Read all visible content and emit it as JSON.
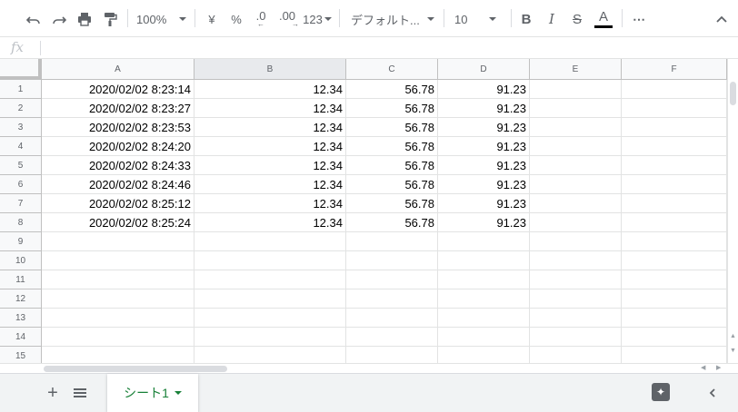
{
  "toolbar": {
    "zoom": "100%",
    "currency": "¥",
    "percent": "%",
    "decrease_decimal": ".0",
    "increase_decimal": ".00",
    "more_formats": "123",
    "font": "デフォルト...",
    "font_size": "10",
    "bold": "B",
    "italic": "I",
    "strikethrough": "S",
    "text_color": "A",
    "more": "⋯"
  },
  "formula_bar": {
    "fx": "fx",
    "value": ""
  },
  "columns": [
    "A",
    "B",
    "C",
    "D",
    "E",
    "F"
  ],
  "rows": [
    {
      "num": "1",
      "cells": [
        "2020/02/02 8:23:14",
        "12.34",
        "56.78",
        "91.23",
        "",
        ""
      ]
    },
    {
      "num": "2",
      "cells": [
        "2020/02/02 8:23:27",
        "12.34",
        "56.78",
        "91.23",
        "",
        ""
      ]
    },
    {
      "num": "3",
      "cells": [
        "2020/02/02 8:23:53",
        "12.34",
        "56.78",
        "91.23",
        "",
        ""
      ]
    },
    {
      "num": "4",
      "cells": [
        "2020/02/02 8:24:20",
        "12.34",
        "56.78",
        "91.23",
        "",
        ""
      ]
    },
    {
      "num": "5",
      "cells": [
        "2020/02/02 8:24:33",
        "12.34",
        "56.78",
        "91.23",
        "",
        ""
      ]
    },
    {
      "num": "6",
      "cells": [
        "2020/02/02 8:24:46",
        "12.34",
        "56.78",
        "91.23",
        "",
        ""
      ]
    },
    {
      "num": "7",
      "cells": [
        "2020/02/02 8:25:12",
        "12.34",
        "56.78",
        "91.23",
        "",
        ""
      ]
    },
    {
      "num": "8",
      "cells": [
        "2020/02/02 8:25:24",
        "12.34",
        "56.78",
        "91.23",
        "",
        ""
      ]
    },
    {
      "num": "9",
      "cells": [
        "",
        "",
        "",
        "",
        "",
        ""
      ]
    },
    {
      "num": "10",
      "cells": [
        "",
        "",
        "",
        "",
        "",
        ""
      ]
    },
    {
      "num": "11",
      "cells": [
        "",
        "",
        "",
        "",
        "",
        ""
      ]
    },
    {
      "num": "12",
      "cells": [
        "",
        "",
        "",
        "",
        "",
        ""
      ]
    },
    {
      "num": "13",
      "cells": [
        "",
        "",
        "",
        "",
        "",
        ""
      ]
    },
    {
      "num": "14",
      "cells": [
        "",
        "",
        "",
        "",
        "",
        ""
      ]
    },
    {
      "num": "15",
      "cells": [
        "",
        "",
        "",
        "",
        "",
        ""
      ]
    }
  ],
  "sheets": [
    {
      "label": "シート1",
      "active": true
    }
  ],
  "colors": {
    "accent": "#188038",
    "header_bg": "#f8f9fa",
    "selected_header_bg": "#e8eaed"
  }
}
